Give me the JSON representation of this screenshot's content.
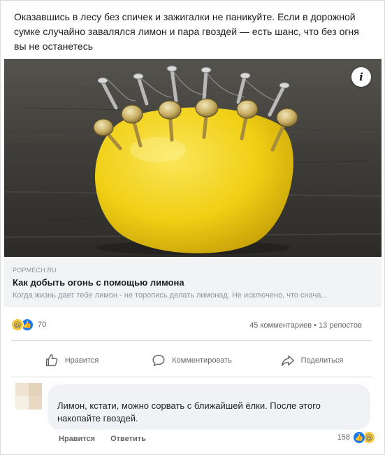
{
  "post": {
    "text": "Оказавшись в лесу без спичек и зажигалки не паникуйте. Если в дорожной сумке случайно завалялся лимон и пара гвоздей — есть шанс, что без огня вы не останетесь"
  },
  "media": {
    "info_icon": "info-icon",
    "alt_subject": "lemon-with-nails"
  },
  "link": {
    "domain": "POPMECH.RU",
    "title": "Как добыть огонь с помощью лимона",
    "description": "Когда жизнь дает тебе лимон - не торопись делать лимонад. Не исключено, что снача..."
  },
  "stats": {
    "reaction_count": "70",
    "comments_reposts": "45 комментариев • 13 репостов"
  },
  "actions": {
    "like": "Нравится",
    "comment": "Комментировать",
    "share": "Поделиться"
  },
  "comment": {
    "text": "Лимон, кстати, можно сорвать с ближайшей ёлки. После этого накопайте гвоздей.",
    "like_label": "Нравится",
    "reply_label": "Ответить",
    "reaction_count": "158"
  },
  "colors": {
    "brand": "#1877f2",
    "lemon": "#f2d21a",
    "haha": "#f7c93e"
  }
}
